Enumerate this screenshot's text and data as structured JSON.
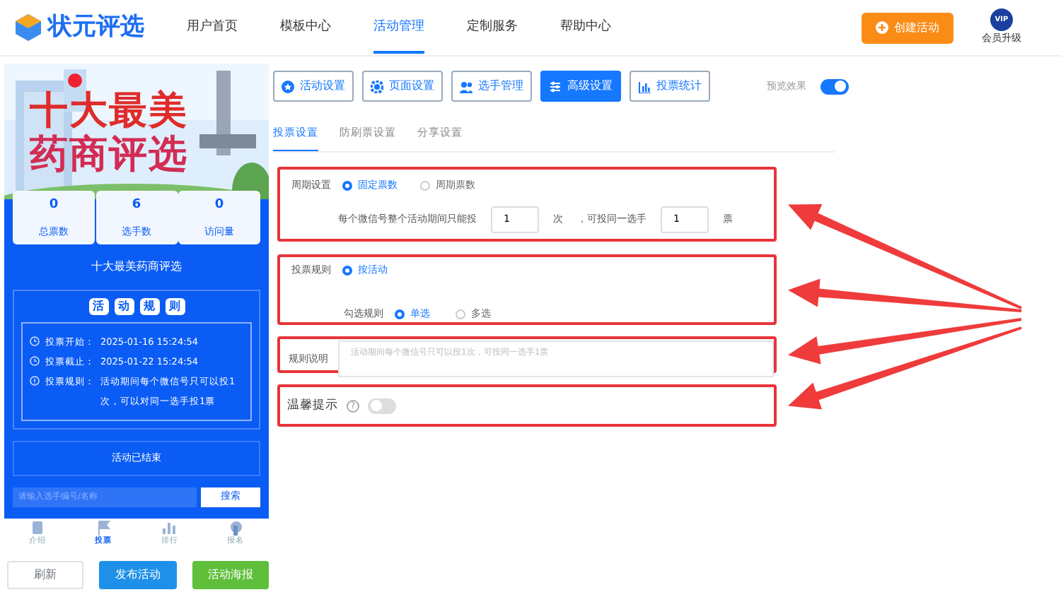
{
  "header": {
    "logo": "状元评选",
    "nav": [
      {
        "label": "用户首页",
        "selected": false
      },
      {
        "label": "模板中心",
        "selected": false
      },
      {
        "label": "活动管理",
        "selected": true
      },
      {
        "label": "定制服务",
        "selected": false
      },
      {
        "label": "帮助中心",
        "selected": false
      }
    ],
    "create_button": "创建活动",
    "vip_badge": "VIP",
    "vip_label": "会员升级"
  },
  "preview": {
    "banner_title": [
      "十大最美",
      "药商评选"
    ],
    "stats": [
      {
        "value": "0",
        "label": "总票数"
      },
      {
        "value": "6",
        "label": "选手数"
      },
      {
        "value": "0",
        "label": "访问量"
      }
    ],
    "title": "十大最美药商评选",
    "rules_heading": [
      "活",
      "动",
      "规",
      "则"
    ],
    "rules": [
      {
        "kind": "clock",
        "label": "投票开始：",
        "value": "2025-01-16 15:24:54"
      },
      {
        "kind": "clock",
        "label": "投票截止：",
        "value": "2025-01-22 15:24:54"
      },
      {
        "kind": "info",
        "label": "投票规则：",
        "value": "活动期间每个微信号只可以投1次，可以对同一选手投1票"
      }
    ],
    "status": "活动已结束",
    "search_placeholder": "请输入选手编号/名称",
    "search_button": "搜索",
    "bottom_nav": [
      {
        "label": "介绍",
        "selected": false
      },
      {
        "label": "投票",
        "selected": true
      },
      {
        "label": "排行",
        "selected": false
      },
      {
        "label": "报名",
        "selected": false
      }
    ]
  },
  "actions": [
    {
      "kind": "plain",
      "label": "刷新"
    },
    {
      "kind": "blue",
      "label": "发布活动"
    },
    {
      "kind": "green",
      "label": "活动海报"
    }
  ],
  "tool_tabs": [
    {
      "label": "活动设置",
      "selected": false
    },
    {
      "label": "页面设置",
      "selected": false
    },
    {
      "label": "选手管理",
      "selected": false
    },
    {
      "label": "高级设置",
      "selected": true
    },
    {
      "label": "投票统计",
      "selected": false
    }
  ],
  "preview_toggle": {
    "label": "预览效果",
    "on": true
  },
  "sub_tabs": [
    {
      "label": "投票设置",
      "selected": true
    },
    {
      "label": "防刷票设置",
      "selected": false
    },
    {
      "label": "分享设置",
      "selected": false
    }
  ],
  "period": {
    "label": "周期设置",
    "options": [
      {
        "label": "固定票数",
        "selected": true
      },
      {
        "label": "周期票数",
        "selected": false
      }
    ],
    "limit_text": "每个微信号整个活动期间只能投",
    "times_value": "1",
    "times_unit": "次",
    "same_text": "，可投同一选手",
    "votes_value": "1",
    "votes_unit": "票"
  },
  "vote_rule": {
    "label": "投票规则",
    "options": [
      {
        "label": "按活动",
        "selected": true
      }
    ],
    "pick_label": "勾选规则",
    "pick_options": [
      {
        "label": "单选",
        "selected": true
      },
      {
        "label": "多选",
        "selected": false
      }
    ]
  },
  "rule_note": {
    "label": "规则说明",
    "placeholder": "活动期间每个微信号只可以投1次，可投同一选手1票"
  },
  "reminder": {
    "label": "温馨提示",
    "help": "?",
    "on": false
  }
}
